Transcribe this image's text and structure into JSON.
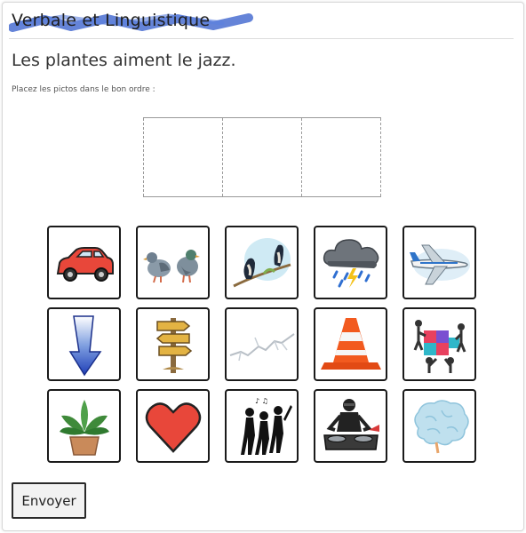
{
  "header": {
    "title": "Verbale et Linguistique",
    "highlight_color": "#4a6fd1"
  },
  "exercise": {
    "sentence": "Les plantes aiment le jazz.",
    "instruction": "Placez les pictos dans le bon ordre :",
    "drop_slots": 3
  },
  "pictograms": [
    {
      "icon": "car-icon",
      "label": "voiture"
    },
    {
      "icon": "pigeons-icon",
      "label": "pigeons"
    },
    {
      "icon": "swallows-icon",
      "label": "hirondelles"
    },
    {
      "icon": "storm-cloud-icon",
      "label": "orage"
    },
    {
      "icon": "airplane-icon",
      "label": "avion"
    },
    {
      "icon": "down-arrow-icon",
      "label": "flèche"
    },
    {
      "icon": "signpost-icon",
      "label": "panneau"
    },
    {
      "icon": "crack-icon",
      "label": "fissure"
    },
    {
      "icon": "traffic-cone-icon",
      "label": "cône"
    },
    {
      "icon": "puzzle-team-icon",
      "label": "puzzle"
    },
    {
      "icon": "potted-plant-icon",
      "label": "plante"
    },
    {
      "icon": "heart-icon",
      "label": "cœur"
    },
    {
      "icon": "jazz-musicians-icon",
      "label": "jazz"
    },
    {
      "icon": "dj-icon",
      "label": "DJ"
    },
    {
      "icon": "brain-icon",
      "label": "cerveau"
    }
  ],
  "actions": {
    "submit_label": "Envoyer"
  }
}
